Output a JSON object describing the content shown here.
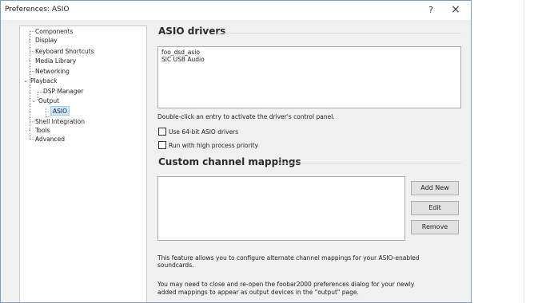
{
  "window": {
    "title": "Preferences: ASIO",
    "help_label": "?",
    "close_label": "×"
  },
  "tree": {
    "items": [
      {
        "label": "Components"
      },
      {
        "label": "Display"
      },
      {
        "label": "Keyboard Shortcuts"
      },
      {
        "label": "Media Library"
      },
      {
        "label": "Networking"
      },
      {
        "label": "Playback"
      },
      {
        "label": "DSP Manager"
      },
      {
        "label": "Output"
      },
      {
        "label": "ASIO"
      },
      {
        "label": "Shell Integration"
      },
      {
        "label": "Tools"
      },
      {
        "label": "Advanced"
      }
    ],
    "selected": "ASIO"
  },
  "asio_drivers": {
    "heading": "ASIO drivers",
    "drivers": [
      "foo_dsd_asio",
      "SIC USB Audio"
    ],
    "hint": "Double-click an entry to activate the driver's control panel.",
    "use64_label": "Use 64-bit ASIO drivers",
    "use64_checked": false,
    "highprio_label": "Run with high process priority",
    "highprio_checked": false
  },
  "custom_mappings": {
    "heading": "Custom channel mappings",
    "add_label": "Add New",
    "edit_label": "Edit",
    "remove_label": "Remove",
    "info1_line1": "This feature allows you to configure alternate channel mappings for your ASIO-enabled",
    "info1_line2": "soundcards.",
    "info2_line1": "You may need to close and re-open the foobar2000 preferences dialog for your newly",
    "info2_line2": "added mappings to appear as output devices in the \"output\" page."
  }
}
